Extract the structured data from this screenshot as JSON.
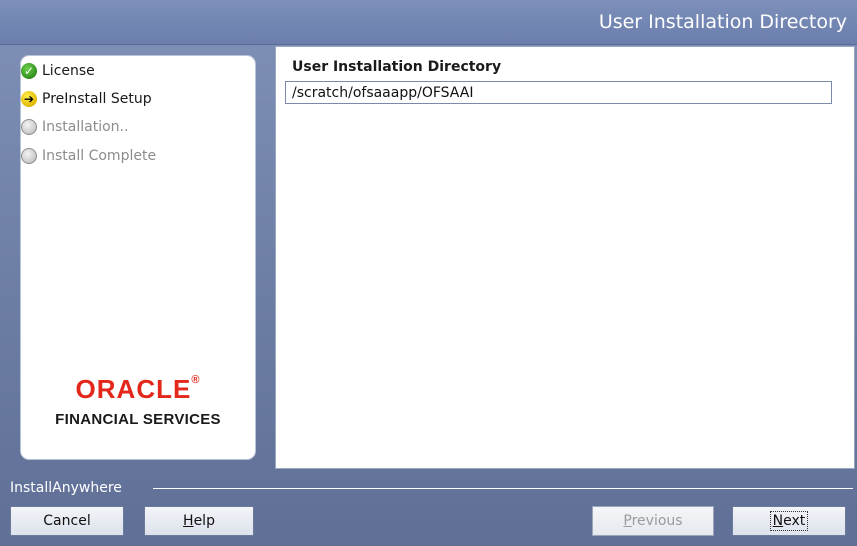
{
  "window": {
    "title": "User Installation Directory"
  },
  "steps": [
    {
      "label": "License",
      "status": "complete",
      "icon": "check-circle-icon"
    },
    {
      "label": "PreInstall Setup",
      "status": "current",
      "icon": "arrow-circle-icon"
    },
    {
      "label": "Installation..",
      "status": "pending",
      "icon": "empty-circle-icon"
    },
    {
      "label": "Install Complete",
      "status": "pending",
      "icon": "empty-circle-icon"
    }
  ],
  "logo": {
    "brand": "ORACLE",
    "trademark": "®",
    "subtitle": "FINANCIAL SERVICES"
  },
  "main": {
    "field_label": "User Installation Directory",
    "field_value": "/scratch/ofsaaapp/OFSAAI"
  },
  "footer": {
    "vendor_label": "InstallAnywhere",
    "buttons": {
      "cancel": "Cancel",
      "help_mnemonic": "H",
      "help_rest": "elp",
      "previous_mnemonic": "P",
      "previous_rest": "revious",
      "next_mnemonic": "N",
      "next_rest": "ext"
    }
  },
  "colors": {
    "window_bg": "#6e7fa6",
    "brand_red": "#e3271b",
    "panel_bg": "#ffffff"
  }
}
